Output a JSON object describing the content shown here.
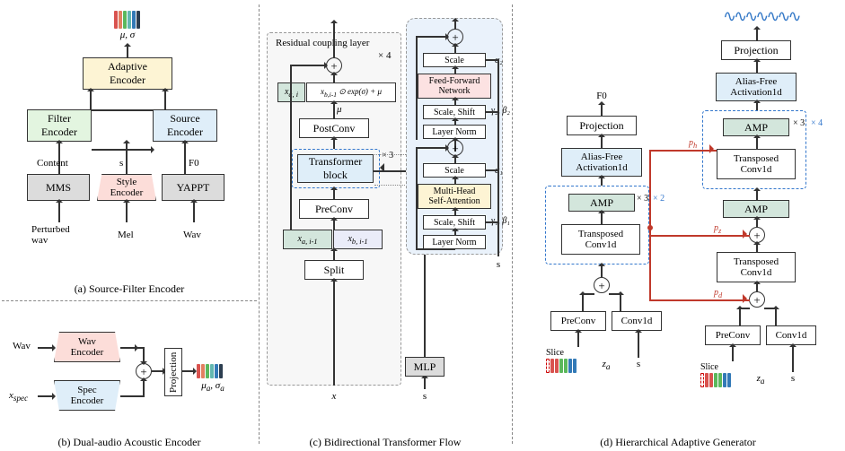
{
  "captions": {
    "a": "(a) Source-Filter Encoder",
    "b": "(b) Dual-audio Acoustic Encoder",
    "c": "(c) Bidirectional Transformer Flow",
    "d": "(d) Hierarchical Adaptive Generator"
  },
  "a": {
    "mms": "MMS",
    "style": "Style\nEncoder",
    "yappt": "YAPPT",
    "pert": "Perturbed\nwav",
    "mel": "Mel",
    "wav": "Wav",
    "filter": "Filter\nEncoder",
    "source": "Source\nEncoder",
    "adaptive": "Adaptive\nEncoder",
    "content": "Content",
    "s": "s",
    "f0": "F0",
    "musig": "μ, σ"
  },
  "b": {
    "wav": "Wav",
    "wavE": "Wav\nEncoder",
    "specE": "Spec\nEncoder",
    "xspec": "xₛₚₑₜ",
    "proj": "Projection",
    "musiga": "μₐ, σₐ"
  },
  "c": {
    "rcl": "Residual coupling layer",
    "x4": "× 4",
    "split": "Split",
    "preconv": "PreConv",
    "tblock": "Transformer\nblock",
    "x3": "× 3",
    "postconv": "PostConv",
    "mu": "μ",
    "xa": "x",
    "sub_a": "a, i−1",
    "xb": "x",
    "sub_b": "b, i−1",
    "xa2": "x",
    "sub_a2": "a, i",
    "exp": "x_{b,i−1} ⊙ exp(σ) + μ",
    "x": "x",
    "s": "s",
    "mlp": "MLP",
    "ln": "Layer Norm",
    "ss": "Scale, Shift",
    "mha": "Multi-Head\nSelf-Attention",
    "scale": "Scale",
    "ffn": "Feed-Forward\nNetwork",
    "a1": "α₁",
    "a2": "α₂",
    "gb1": "γ₁, β₁",
    "gb2": "γ₂, β₂"
  },
  "d": {
    "F0": "F0",
    "proj": "Projection",
    "af": "Alias-Free\nActivation1d",
    "amp": "AMP",
    "tc": "Transposed\nConv1d",
    "preconv": "PreConv",
    "conv": "Conv1d",
    "slice": "Slice",
    "za": "zₐ",
    "s": "s",
    "x3": "× 3",
    "x2": "× 2",
    "x4": "× 4",
    "pd": "p_d",
    "pz": "p_z",
    "ph": "p_h"
  }
}
